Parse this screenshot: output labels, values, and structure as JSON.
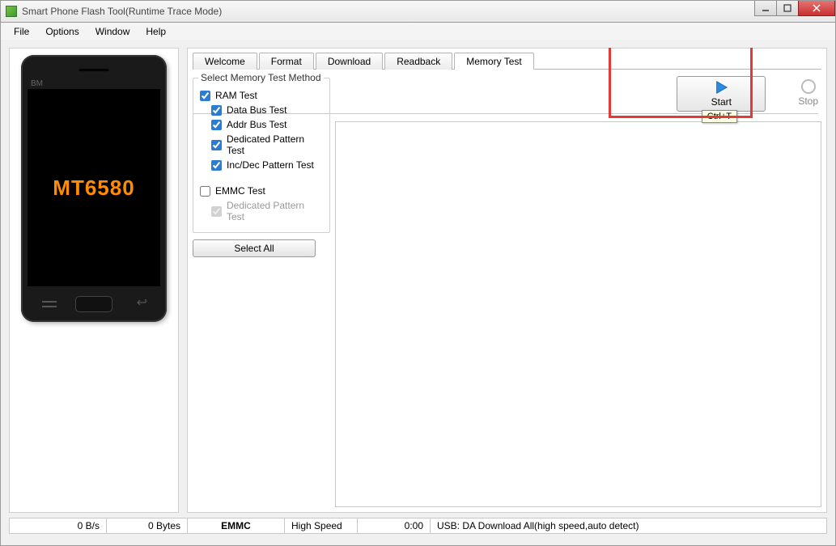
{
  "window": {
    "title": "Smart Phone Flash Tool(Runtime Trace Mode)"
  },
  "menu": {
    "file": "File",
    "options": "Options",
    "window": "Window",
    "help": "Help"
  },
  "phone": {
    "bm": "BM",
    "chipset": "MT6580"
  },
  "tabs": {
    "welcome": "Welcome",
    "format": "Format",
    "download": "Download",
    "readback": "Readback",
    "memory_test": "Memory Test"
  },
  "memtest": {
    "group_label": "Select Memory Test Method",
    "ram_test": "RAM Test",
    "data_bus_test": "Data Bus Test",
    "addr_bus_test": "Addr Bus Test",
    "dedicated_pattern_test": "Dedicated Pattern Test",
    "inc_dec_pattern_test": "Inc/Dec Pattern Test",
    "emmc_test": "EMMC Test",
    "emmc_dedicated": "Dedicated Pattern Test",
    "select_all": "Select All"
  },
  "actions": {
    "start": "Start",
    "stop": "Stop",
    "tooltip": "Ctrl+T"
  },
  "status": {
    "speed": "0 B/s",
    "bytes": "0 Bytes",
    "storage": "EMMC",
    "mode": "High Speed",
    "time": "0:00",
    "usb": "USB: DA Download All(high speed,auto detect)"
  }
}
